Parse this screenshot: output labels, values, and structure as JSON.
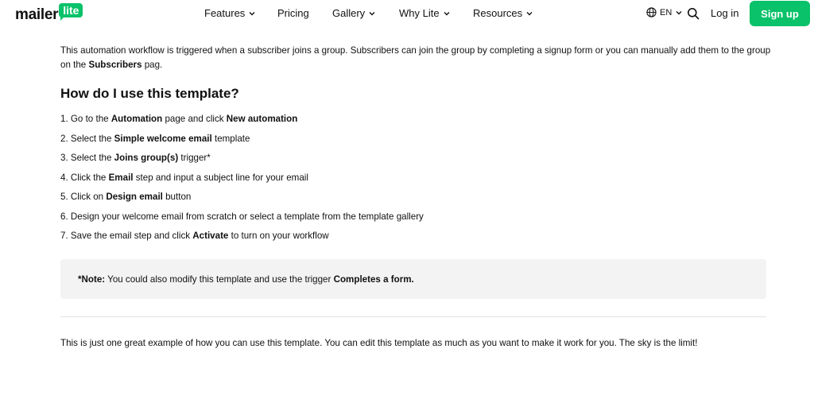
{
  "header": {
    "logo": {
      "word": "mailer",
      "badge": "lite"
    },
    "nav": [
      {
        "label": "Features",
        "has_dropdown": true
      },
      {
        "label": "Pricing",
        "has_dropdown": false
      },
      {
        "label": "Gallery",
        "has_dropdown": true
      },
      {
        "label": "Why Lite",
        "has_dropdown": true
      },
      {
        "label": "Resources",
        "has_dropdown": true
      }
    ],
    "language": {
      "code": "EN",
      "icon": "globe-icon"
    },
    "search_icon": "search-icon",
    "login_label": "Log in",
    "signup_label": "Sign up",
    "accent_color": "#09c269"
  },
  "main": {
    "intro": {
      "text_1": "This automation workflow is triggered when a subscriber joins a group. Subscribers can join the group by completing a signup form or you can manually add them to the group on the ",
      "bold_1": "Subscribers",
      "text_2": " pag."
    },
    "heading": "How do I use this template?",
    "steps": [
      {
        "prefix": "1. Go to the ",
        "b1": "Automation",
        "mid": " page and click ",
        "b2": "New automation",
        "suffix": ""
      },
      {
        "prefix": "2. Select the ",
        "b1": "Simple welcome email",
        "mid": " template",
        "b2": "",
        "suffix": ""
      },
      {
        "prefix": "3. Select the ",
        "b1": "Joins group(s)",
        "mid": " trigger*",
        "b2": "",
        "suffix": ""
      },
      {
        "prefix": "4. Click the ",
        "b1": "Email",
        "mid": " step and input a subject line for your email",
        "b2": "",
        "suffix": ""
      },
      {
        "prefix": "5. Click on ",
        "b1": "Design email",
        "mid": " button",
        "b2": "",
        "suffix": ""
      },
      {
        "prefix": "6. Design your welcome email from scratch or select a template from the template gallery",
        "b1": "",
        "mid": "",
        "b2": "",
        "suffix": ""
      },
      {
        "prefix": "7. Save the email step and click ",
        "b1": "Activate",
        "mid": " to turn on your workflow",
        "b2": "",
        "suffix": ""
      }
    ],
    "note": {
      "label": "*Note:",
      "text": " You could also modify this template and use the trigger ",
      "bold": "Completes a form."
    },
    "outro": "This is just one great example of how you can use this template. You can edit this template as much as you want to make it work for you. The sky is the limit!"
  }
}
